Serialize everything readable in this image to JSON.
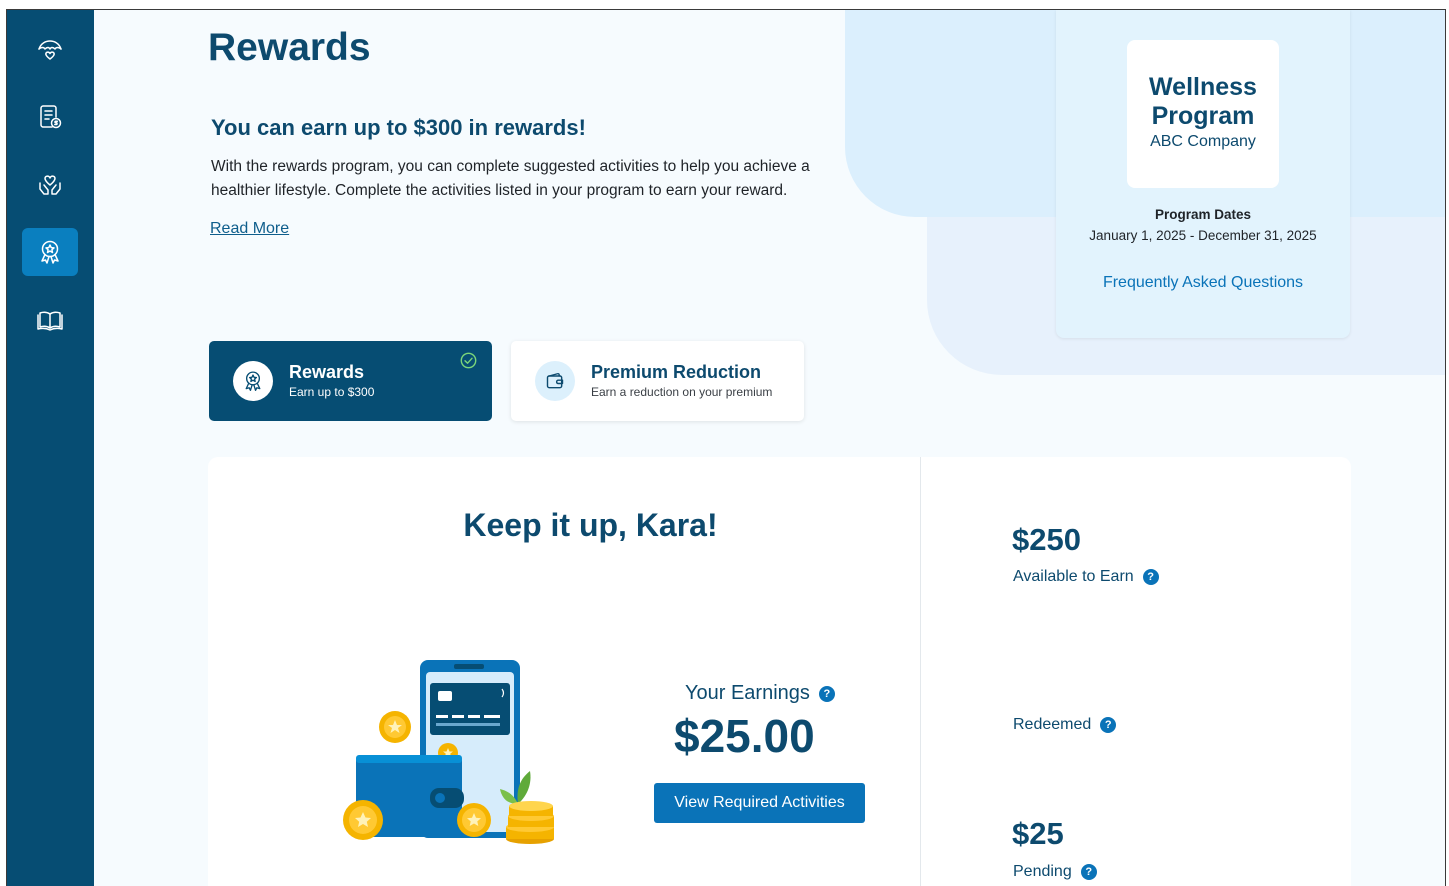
{
  "page": {
    "title": "Rewards",
    "headline": "You can earn up to $300 in  rewards!",
    "intro": "With the rewards program, you can complete suggested activities to help you achieve a healthier lifestyle. Complete the activities listed in your program to earn your reward.",
    "read_more": "Read More"
  },
  "sidebar": {
    "items": [
      {
        "name": "care-home",
        "icon": "umbrella-heart-icon"
      },
      {
        "name": "claims",
        "icon": "document-dollar-icon"
      },
      {
        "name": "wellness",
        "icon": "hands-heart-icon"
      },
      {
        "name": "rewards",
        "icon": "award-ribbon-icon",
        "active": true
      },
      {
        "name": "library",
        "icon": "open-book-icon"
      }
    ]
  },
  "program": {
    "logo_title": "Wellness Program",
    "logo_subtitle": "ABC Company",
    "dates_label": "Program Dates",
    "dates_value": "January 1, 2025 - December 31, 2025",
    "faq": "Frequently Asked Questions"
  },
  "tabs": [
    {
      "title": "Rewards",
      "subtitle": "Earn up to $300",
      "selected": true
    },
    {
      "title": "Premium Reduction",
      "subtitle": "Earn a reduction on your premium",
      "selected": false
    }
  ],
  "summary": {
    "greeting": "Keep it up, Kara!",
    "earnings_label": "Your Earnings",
    "earnings_amount": "$25.00",
    "cta": "View Required Activities",
    "available_amount": "$250",
    "available_label": "Available to Earn",
    "redeemed_label": "Redeemed",
    "pending_amount": "$25",
    "pending_label": "Pending",
    "help_glyph": "?"
  },
  "colors": {
    "sidebar": "#064d73",
    "active_nav": "#0a7fbf",
    "brand_dark": "#0d4a6e",
    "button": "#0a73b8"
  }
}
